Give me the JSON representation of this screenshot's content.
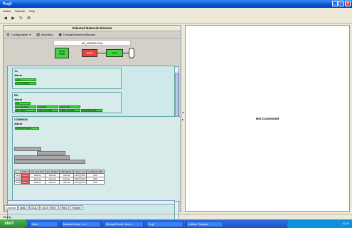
{
  "window": {
    "title": "Proj1"
  },
  "menu": [
    "Action",
    "Refresh",
    "Help"
  ],
  "toolbar_icons": [
    "back-icon",
    "forward-icon",
    "refresh-icon",
    "settings-icon"
  ],
  "panel": {
    "title": "Selected Network Element",
    "nav": [
      "Configuration",
      "Inventory",
      "Cellular/Inventory/Monitor"
    ],
    "element_label": "AP_0064513419",
    "diagram": {
      "nodes": [
        "ALM",
        "PWR",
        "BSS",
        "GPS"
      ]
    }
  },
  "groups": {
    "ran": {
      "title": "Tx",
      "subtitle": "Alarm",
      "alarms": [
        "ALC",
        "TX O/P LOW"
      ]
    },
    "rx": {
      "title": "RX",
      "subtitle": "Alarm",
      "alarms": [
        "LO",
        "LO UNLOCK",
        "LO2 SQ",
        "AUTO RX",
        "DC INPUT",
        "MAST ALARM",
        "TEMP ALARM",
        "RX/O/P LOSS"
      ]
    },
    "common": {
      "title": "COMMON",
      "subtitle": "Alarm",
      "alarms": [
        "PSU OUT LOW"
      ]
    }
  },
  "table": {
    "headers": [
      "",
      "INPUT",
      "O/P OUT PUT",
      "ATT. RESET",
      "AMP RESET",
      "LNA",
      "CH",
      "ALARM INHIBIT"
    ],
    "rows": [
      [
        "CH1",
        "Alarm",
        "Normal",
        "Normal",
        "Normal",
        "OFF",
        "OFF",
        "OFF"
      ],
      [
        "CH2",
        "Alarm",
        "Normal",
        "Normal",
        "Normal",
        "OFF",
        "OFF",
        "OFF"
      ],
      [
        "CH3",
        "Alarm",
        "Normal",
        "Normal",
        "Normal",
        "OFF",
        "OFF",
        "OFF"
      ]
    ]
  },
  "tabs": [
    "Overall",
    "BBU",
    "ODU",
    "AGS TEST",
    "PAK",
    "Viewer"
  ],
  "right_panel": {
    "status": "Not Connected"
  },
  "statusbar": {
    "text": "Ready"
  },
  "taskbar": {
    "start": "start",
    "tasks": [
      "Inbox",
      "Microsoft Excel - Lis...",
      "Microsoft Excel - Book...",
      "Proj1",
      "Untitled - Notepad"
    ],
    "clock": "10:26"
  }
}
